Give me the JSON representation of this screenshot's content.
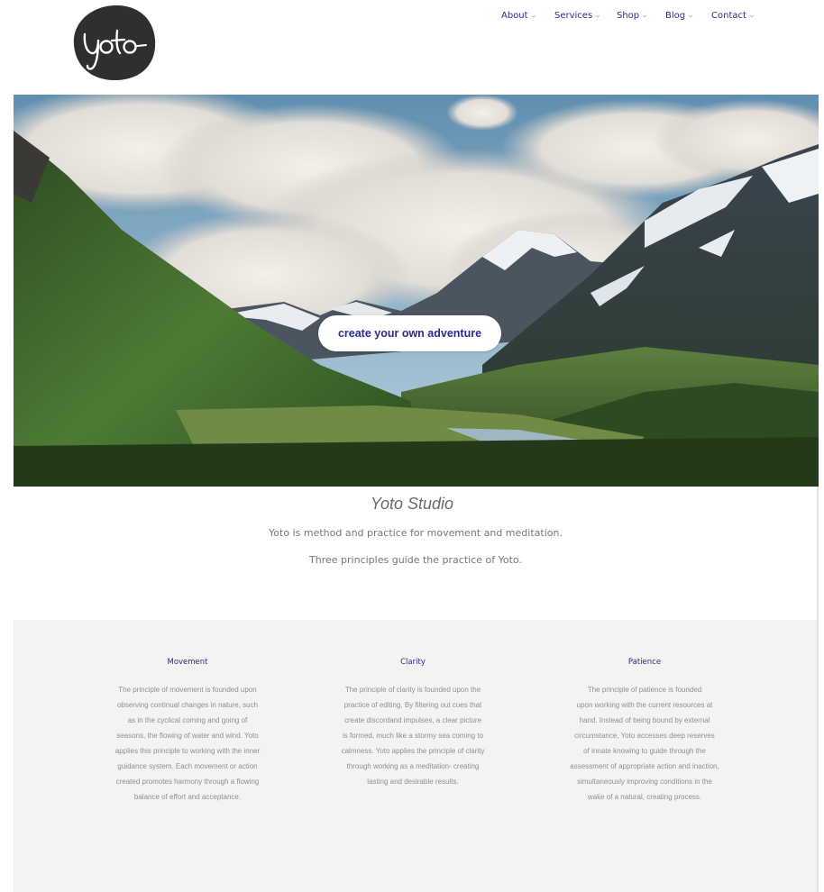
{
  "header": {
    "logo_text": "Yoto",
    "nav": [
      {
        "label": "About"
      },
      {
        "label": "Services"
      },
      {
        "label": "Shop"
      },
      {
        "label": "Blog"
      },
      {
        "label": "Contact"
      }
    ]
  },
  "hero": {
    "cta_label": "create your own adventure",
    "image_alt": "mountain-valley-photo"
  },
  "intro": {
    "title": "Yoto Studio",
    "line1": "Yoto is method and practice for movement and meditation.",
    "line2": "Three principles guide the practice of Yoto."
  },
  "principles": [
    {
      "title": "Movement",
      "lines": [
        "The principle of movement is founded upon",
        "observing continual changes in nature, such",
        "as in the cyclical coming and going of",
        "seasons, the flowing of water and wind. Yoto",
        "applies this principle to working with the inner",
        "guidance system. Each movement or action",
        "created promotes harmony through a flowing",
        "balance of effort and acceptance."
      ]
    },
    {
      "title": "Clarity",
      "lines": [
        "The principle of clarity is founded upon the",
        "practice of editing. By filtering out cues that",
        "create discordand impulses, a clear picture",
        "is formed, much like a stormy sea coming to",
        "calmness. Yoto applies the principle of clarity",
        "through working as a meditation- creating",
        "lasting and desirable results."
      ]
    },
    {
      "title": "Patience",
      "lines": [
        "The principle of patience is founded",
        "upon working with the current resources at",
        "hand. Instead of being bound by external",
        "circumstance, Yoto accesses deep reserves",
        "of innate knowing to guide through the",
        "assessment of appropriate action and inaction,",
        "simultaneously improving conditions in the",
        "wake of a natural, creating process."
      ]
    }
  ],
  "colors": {
    "accent": "#2b2b8c",
    "logo_bg": "#2f2f2f",
    "section_bg": "#f3f3f3",
    "body_text": "#8f8f8f"
  }
}
